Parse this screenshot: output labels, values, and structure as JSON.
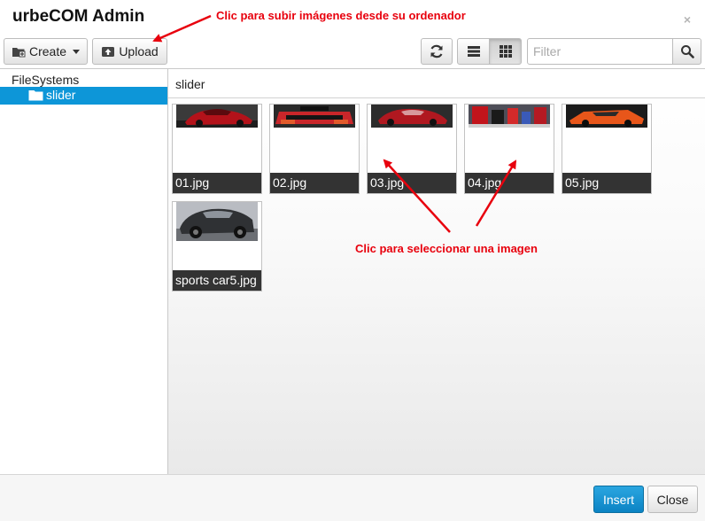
{
  "window": {
    "title": "urbeCOM Admin",
    "close_glyph": "×"
  },
  "annotations": {
    "upload_hint": "Clic para subir imágenes desde su ordenador",
    "select_hint": "Clic para seleccionar una imagen"
  },
  "toolbar": {
    "create_label": "Create",
    "upload_label": "Upload",
    "filter_placeholder": "Filter"
  },
  "tree": {
    "root_label": "FileSystems",
    "items": [
      {
        "label": "slider",
        "selected": true
      }
    ]
  },
  "browser": {
    "current_path": "slider",
    "files": [
      {
        "name": "01.jpg"
      },
      {
        "name": "02.jpg"
      },
      {
        "name": "03.jpg"
      },
      {
        "name": "04.jpg"
      },
      {
        "name": "05.jpg"
      },
      {
        "name": "sports car5.jpg"
      }
    ]
  },
  "footer": {
    "insert_label": "Insert",
    "close_label": "Close"
  },
  "colors": {
    "accent": "#0d96d8",
    "annotation": "#e8000d",
    "caption_bg": "#333333"
  },
  "icons": [
    "folder-plus-icon",
    "upload-icon",
    "refresh-icon",
    "list-view-icon",
    "grid-view-icon",
    "search-icon",
    "folder-icon"
  ]
}
